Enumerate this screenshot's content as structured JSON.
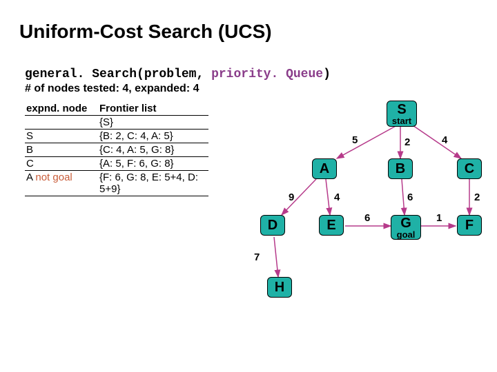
{
  "title": "Uniform-Cost Search (UCS)",
  "code": {
    "fn": "general. Search",
    "arg1": "(problem, ",
    "arg2": "priority. Queue",
    "tail": ")"
  },
  "stats": "# of nodes tested: 4, expanded: 4",
  "table": {
    "head_node": "expnd. node",
    "head_frontier": "Frontier list",
    "rows": [
      {
        "node": "",
        "frontier": "{S}"
      },
      {
        "node": "S",
        "frontier": "{B: 2, C: 4, A: 5}"
      },
      {
        "node": "B",
        "frontier": "{C: 4, A: 5, G: 8}"
      },
      {
        "node": "C",
        "frontier": "{A: 5, F: 6, G: 8}"
      },
      {
        "node": "A",
        "node_suffix": "not goal",
        "frontier": "{F: 6, G: 8, E: 5+4, D: 5+9}"
      }
    ]
  },
  "graph": {
    "nodes": {
      "S": {
        "label": "S",
        "sub": "start"
      },
      "A": {
        "label": "A"
      },
      "B": {
        "label": "B"
      },
      "C": {
        "label": "C"
      },
      "D": {
        "label": "D"
      },
      "E": {
        "label": "E"
      },
      "G": {
        "label": "G",
        "sub": "goal"
      },
      "F": {
        "label": "F"
      },
      "H": {
        "label": "H"
      }
    },
    "edges": {
      "SA": "5",
      "SB": "2",
      "SC": "4",
      "AD": "9",
      "AE": "4",
      "BG": "6",
      "CF": "2",
      "EG": "6",
      "GF": "1",
      "DH": "7"
    }
  }
}
